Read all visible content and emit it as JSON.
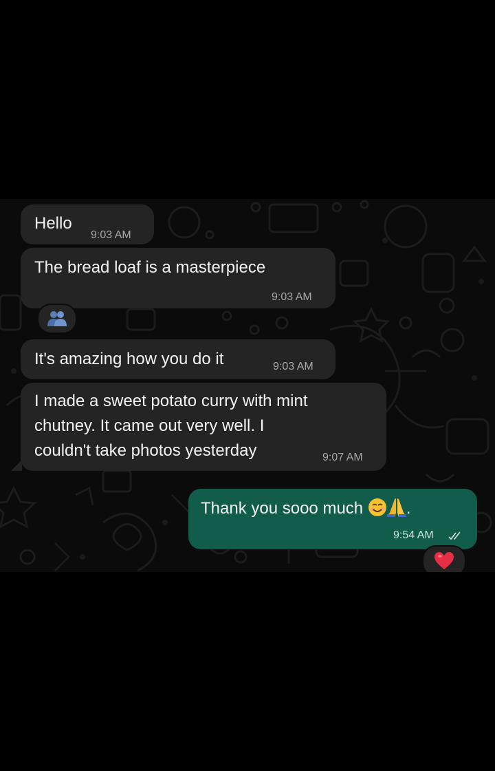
{
  "messages": [
    {
      "text": "Hello",
      "time": "9:03 AM"
    },
    {
      "text": "The bread loaf is a masterpiece",
      "time": "9:03 AM"
    },
    {
      "text": "It's amazing how you do it",
      "time": "9:03 AM"
    },
    {
      "lines": [
        "I made a sweet potato curry with mint",
        "chutney. It came out very well. I",
        "couldn't take photos yesterday"
      ],
      "time": "9:07 AM"
    },
    {
      "text": "Thank you sooo much",
      "suffix": ".",
      "time": "9:54 AM"
    }
  ],
  "icons": {
    "reaction_group": "people-icon",
    "reaction_heart": "heart-icon",
    "read_status": "double-check-icon",
    "emoji_1": "smiling-face-icon",
    "emoji_2": "folded-hands-icon"
  },
  "colors": {
    "incoming_bubble": "#242424",
    "outgoing_bubble": "#125c4b",
    "background": "#0b0b0b"
  }
}
